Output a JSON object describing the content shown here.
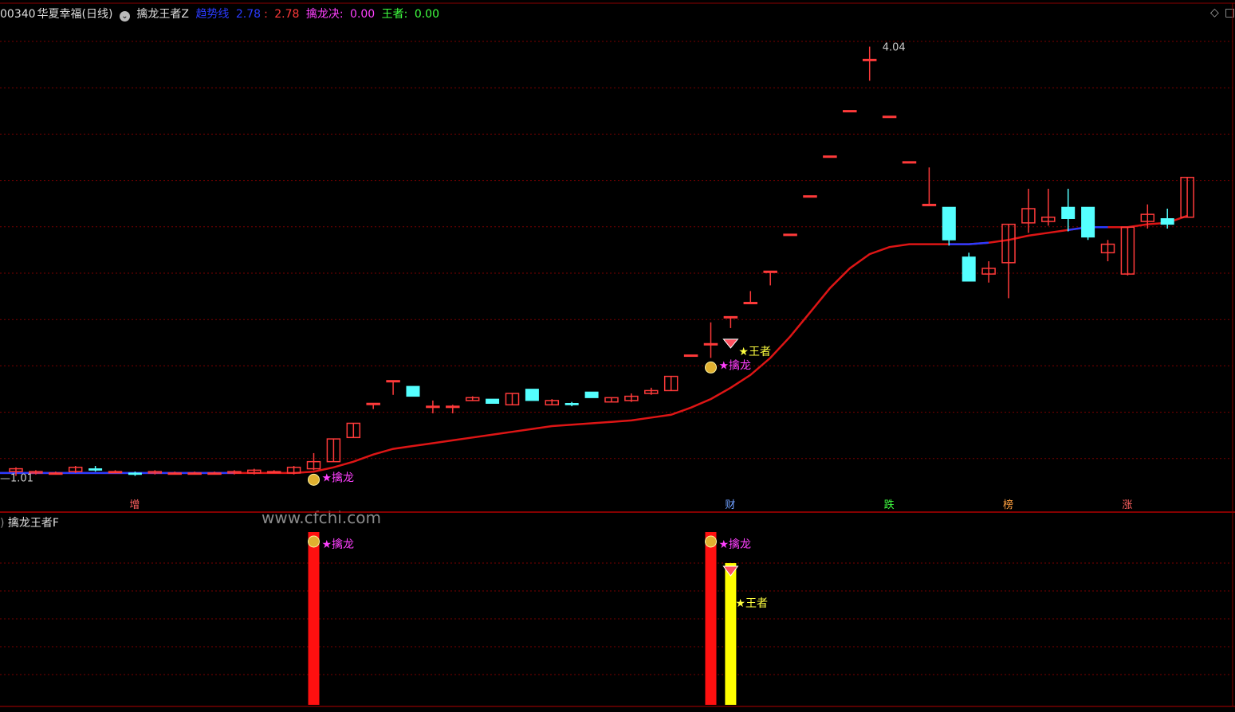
{
  "header": {
    "code": "00340",
    "name": "华夏幸福(日线)",
    "indicator_icon": "chevron-circle-icon",
    "indicator": "擒龙王者Z",
    "trend_label": "趋势线",
    "trend_value1": "2.78",
    "trend_sep": ":",
    "trend_value2": "2.78",
    "qinlongjue_label": "擒龙决",
    "qinlongjue_value": "0.00",
    "wangzhe_label": "王者",
    "wangzhe_value": "0.00"
  },
  "sub_panel": {
    "title": "擒龙王者F",
    "watermark": "www.cfchi.com"
  },
  "icons": {
    "diamond": "diamond-icon",
    "square": "square-icon"
  },
  "colors": {
    "up": "#ff3a3a",
    "down": "#54ffff",
    "trend": "#dd1515",
    "trend_flat": "#2b3bff",
    "grid": "#7a0000",
    "label_qinlong": "#ff40ff",
    "label_wangzhe": "#ffff40",
    "bar_red": "#ff1010",
    "bar_yellow": "#ffff00"
  },
  "chart_data": {
    "type": "candlestick",
    "ylim": [
      0.95,
      4.2
    ],
    "high_label": "4.04",
    "low_label": "1.01",
    "candles": [
      [
        1.05,
        1.07,
        1.02,
        1.08
      ],
      [
        1.04,
        1.05,
        1.03,
        1.06
      ],
      [
        1.04,
        1.04,
        1.03,
        1.05
      ],
      [
        1.05,
        1.08,
        1.04,
        1.09
      ],
      [
        1.07,
        1.06,
        1.05,
        1.09
      ],
      [
        1.05,
        1.05,
        1.04,
        1.06
      ],
      [
        1.04,
        1.03,
        1.02,
        1.05
      ],
      [
        1.04,
        1.05,
        1.03,
        1.06
      ],
      [
        1.04,
        1.04,
        1.03,
        1.05
      ],
      [
        1.04,
        1.04,
        1.03,
        1.05
      ],
      [
        1.04,
        1.04,
        1.03,
        1.05
      ],
      [
        1.04,
        1.05,
        1.03,
        1.06
      ],
      [
        1.04,
        1.06,
        1.03,
        1.07
      ],
      [
        1.05,
        1.05,
        1.04,
        1.06
      ],
      [
        1.04,
        1.08,
        1.03,
        1.09
      ],
      [
        1.07,
        1.12,
        1.06,
        1.18
      ],
      [
        1.12,
        1.28,
        1.12,
        1.28
      ],
      [
        1.29,
        1.39,
        1.29,
        1.39
      ],
      [
        1.53,
        1.53,
        1.49,
        1.53
      ],
      [
        1.69,
        1.69,
        1.59,
        1.69
      ],
      [
        1.65,
        1.58,
        1.58,
        1.65
      ],
      [
        1.51,
        1.51,
        1.46,
        1.55
      ],
      [
        1.51,
        1.51,
        1.46,
        1.52
      ],
      [
        1.55,
        1.57,
        1.55,
        1.58
      ],
      [
        1.56,
        1.53,
        1.53,
        1.56
      ],
      [
        1.52,
        1.6,
        1.52,
        1.6
      ],
      [
        1.63,
        1.55,
        1.55,
        1.63
      ],
      [
        1.52,
        1.55,
        1.52,
        1.56
      ],
      [
        1.53,
        1.52,
        1.51,
        1.54
      ],
      [
        1.61,
        1.57,
        1.57,
        1.61
      ],
      [
        1.54,
        1.57,
        1.54,
        1.57
      ],
      [
        1.55,
        1.58,
        1.54,
        1.6
      ],
      [
        1.6,
        1.62,
        1.59,
        1.64
      ],
      [
        1.62,
        1.72,
        1.62,
        1.72
      ],
      [
        1.87,
        1.87,
        1.87,
        1.87
      ],
      [
        1.95,
        1.95,
        1.85,
        2.1
      ],
      [
        2.14,
        2.14,
        2.06,
        2.14
      ],
      [
        2.24,
        2.24,
        2.24,
        2.32
      ],
      [
        2.46,
        2.46,
        2.36,
        2.46
      ],
      [
        2.72,
        2.72,
        2.72,
        2.72
      ],
      [
        2.99,
        2.99,
        2.99,
        2.99
      ],
      [
        3.27,
        3.27,
        3.27,
        3.27
      ],
      [
        3.59,
        3.59,
        3.59,
        3.59
      ],
      [
        3.95,
        3.95,
        3.8,
        4.04
      ],
      [
        3.55,
        3.55,
        3.55,
        3.55
      ],
      [
        3.23,
        3.23,
        3.23,
        3.23
      ],
      [
        2.93,
        2.93,
        2.93,
        3.19
      ],
      [
        2.91,
        2.68,
        2.64,
        2.91
      ],
      [
        2.56,
        2.39,
        2.39,
        2.59
      ],
      [
        2.44,
        2.48,
        2.38,
        2.53
      ],
      [
        2.52,
        2.79,
        2.27,
        2.79
      ],
      [
        2.8,
        2.9,
        2.73,
        3.04
      ],
      [
        2.81,
        2.84,
        2.78,
        3.04
      ],
      [
        2.91,
        2.83,
        2.74,
        3.04
      ],
      [
        2.91,
        2.7,
        2.68,
        2.91
      ],
      [
        2.59,
        2.65,
        2.53,
        2.68
      ],
      [
        2.44,
        2.77,
        2.43,
        2.77
      ],
      [
        2.81,
        2.86,
        2.76,
        2.93
      ],
      [
        2.83,
        2.79,
        2.76,
        2.9
      ],
      [
        2.84,
        3.12,
        2.84,
        3.12
      ]
    ],
    "trend_line": [
      1.04,
      1.04,
      1.04,
      1.04,
      1.04,
      1.04,
      1.04,
      1.04,
      1.04,
      1.04,
      1.04,
      1.04,
      1.04,
      1.04,
      1.04,
      1.05,
      1.08,
      1.12,
      1.17,
      1.21,
      1.23,
      1.25,
      1.27,
      1.29,
      1.31,
      1.33,
      1.35,
      1.37,
      1.38,
      1.39,
      1.4,
      1.41,
      1.43,
      1.45,
      1.5,
      1.56,
      1.64,
      1.73,
      1.85,
      2.0,
      2.17,
      2.34,
      2.48,
      2.58,
      2.63,
      2.65,
      2.65,
      2.65,
      2.65,
      2.66,
      2.68,
      2.71,
      2.73,
      2.75,
      2.77,
      2.77,
      2.77,
      2.79,
      2.8,
      2.85
    ],
    "trend_flat_segments": [
      [
        0,
        11
      ],
      [
        47,
        49
      ],
      [
        53,
        55
      ]
    ],
    "signals": [
      {
        "index": 15,
        "type": "qinlong",
        "text": "★擒龙"
      },
      {
        "index": 35,
        "type": "qinlong",
        "text": "★擒龙"
      },
      {
        "index": 36,
        "type": "wangzhe",
        "text": "★王者"
      }
    ],
    "bottom_markers": [
      {
        "index": 6,
        "text": "增",
        "color": "#ff6060"
      },
      {
        "index": 36,
        "text": "财",
        "color": "#6fa0ff"
      },
      {
        "index": 44,
        "text": "跌",
        "color": "#40ff40"
      },
      {
        "index": 50,
        "text": "榜",
        "color": "#ffa040"
      },
      {
        "index": 56,
        "text": "涨",
        "color": "#ff6060"
      }
    ],
    "sub_bars": [
      {
        "index": 15,
        "color": "red",
        "value": 1.0,
        "text": "★擒龙"
      },
      {
        "index": 35,
        "color": "red",
        "value": 1.0,
        "text": "★擒龙"
      },
      {
        "index": 36,
        "color": "yellow",
        "value": 0.82,
        "text": "★王者"
      }
    ]
  }
}
